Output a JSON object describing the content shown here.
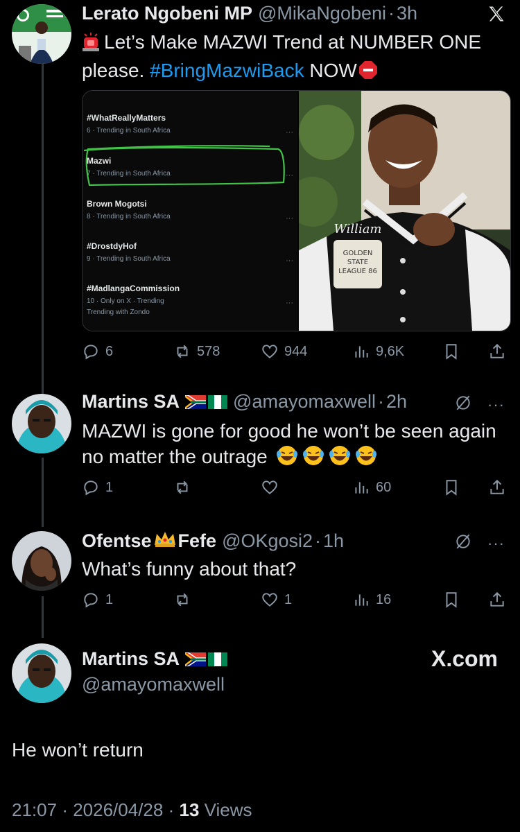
{
  "tweets": [
    {
      "name": "Lerato Ngobeni MP",
      "handle": "@MikaNgobeni",
      "time": "3h",
      "text_prefix": "Let’s Make MAZWI Trend at NUMBER ONE please. ",
      "hashtag": "#BringMazwiBack",
      "text_suffix": " NOW",
      "metrics": {
        "replies": "6",
        "reposts": "578",
        "likes": "944",
        "views": "9,6K"
      }
    },
    {
      "name": "Martins SA",
      "handle": "@amayomaxwell",
      "time": "2h",
      "text": "MAZWI is gone for good he won’t be seen again no matter the outrage",
      "metrics": {
        "replies": "1",
        "reposts": "",
        "likes": "",
        "views": "60"
      }
    },
    {
      "name_part1": "Ofentse",
      "name_part2": "Fefe",
      "handle": "@OKgosi2",
      "time": "1h",
      "text": "What’s funny about that?",
      "metrics": {
        "replies": "1",
        "reposts": "",
        "likes": "1",
        "views": "16"
      }
    }
  ],
  "trending": [
    {
      "title": "#WhatReallyMatters",
      "sub": "6 · Trending in South Africa"
    },
    {
      "title": "Mazwi",
      "sub": "7 · Trending in South Africa"
    },
    {
      "title": "Brown Mogotsi",
      "sub": "8 · Trending in South Africa"
    },
    {
      "title": "#DrostdyHof",
      "sub": "9 · Trending in South Africa"
    },
    {
      "title": "#MadlangaCommission",
      "sub": "10 · Only on X · Trending",
      "sub2": "Trending with Zondo"
    }
  ],
  "jacket_text": {
    "brand": "William",
    "patch": "GOLDEN STATE LEAGUE 86"
  },
  "main": {
    "name": "Martins SA",
    "handle": "@amayomaxwell",
    "text": "He won’t return",
    "time": "21:07",
    "date": "2026/04/28",
    "views_count": "13",
    "views_label": "Views",
    "watermark": "X.com"
  },
  "colors": {
    "accent": "#1d9bf0",
    "muted": "#8b98a5",
    "highlight_box": "#43c24a"
  },
  "icons": [
    "x-logo-icon",
    "siren-icon",
    "stop-icon",
    "reply-icon",
    "repost-icon",
    "like-icon",
    "views-icon",
    "bookmark-icon",
    "share-icon",
    "grok-icon",
    "more-icon",
    "sa-flag-icon",
    "ng-flag-icon",
    "crown-icon",
    "laugh-emoji-icon"
  ]
}
